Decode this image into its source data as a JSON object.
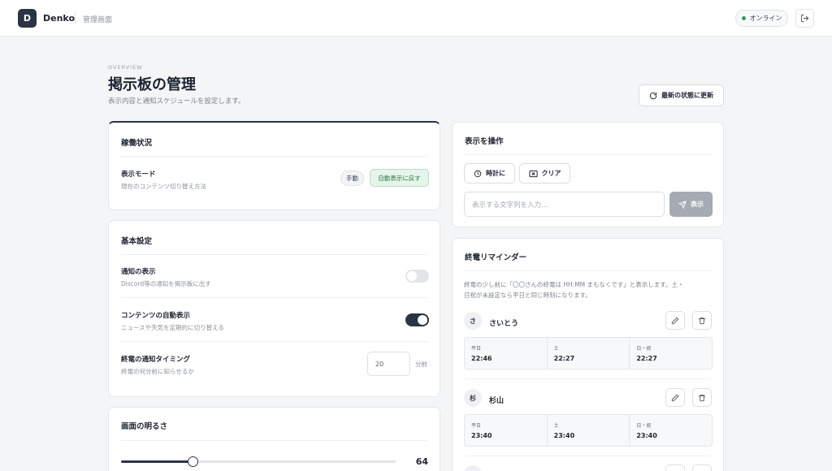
{
  "header": {
    "logo_letter": "D",
    "app_name": "Denko",
    "subtitle": "管理画面",
    "status": "オンライン"
  },
  "page": {
    "eyebrow": "OVERVIEW",
    "title": "掲示板の管理",
    "subtitle": "表示内容と通知スケジュールを設定します。",
    "refresh_label": "最新の状態に更新"
  },
  "status_card": {
    "title": "稼働状況",
    "mode_title": "表示モード",
    "mode_sub": "現在のコンテンツ切り替え方法",
    "manual_chip": "手動",
    "auto_button": "自動表示に戻す"
  },
  "basic_card": {
    "title": "基本設定",
    "notify_title": "通知の表示",
    "notify_sub": "Discord等の通知を掲示板に出す",
    "notify_on": false,
    "auto_title": "コンテンツの自動表示",
    "auto_sub": "ニュースや天気を定期的に切り替える",
    "auto_on": true,
    "timing_title": "終電の通知タイミング",
    "timing_sub": "終電の何分前に知らせるか",
    "timing_value": "20",
    "timing_unit": "分前"
  },
  "brightness_card": {
    "title": "画面の明るさ",
    "value": "64",
    "level": 0.26
  },
  "operate_card": {
    "title": "表示を操作",
    "clock_button": "時計に",
    "clear_button": "クリア",
    "input_placeholder": "表示する文字列を入力...",
    "send_button": "表示"
  },
  "reminder_card": {
    "title": "終電リマインダー",
    "description_line1": "終電の少し前に「〇〇さんの終電は HH:MM まもなくです」と表示します。土・",
    "description_line2": "日祝が未設定なら平日と同じ時刻になります。",
    "people": [
      {
        "initial": "さ",
        "name": "さいとう",
        "times": [
          {
            "label": "平日",
            "value": "22:46"
          },
          {
            "label": "土",
            "value": "22:27"
          },
          {
            "label": "日・祝",
            "value": "22:27"
          }
        ]
      },
      {
        "initial": "杉",
        "name": "杉山",
        "times": [
          {
            "label": "平日",
            "value": "23:40"
          },
          {
            "label": "土",
            "value": "23:40"
          },
          {
            "label": "日・祝",
            "value": "23:40"
          }
        ]
      }
    ]
  },
  "colors": {
    "primary": "#2b3444",
    "accent_green": "#2f9e5a",
    "chip_green_bg": "#e6f4ea",
    "chip_green_text": "#2f7a45"
  }
}
